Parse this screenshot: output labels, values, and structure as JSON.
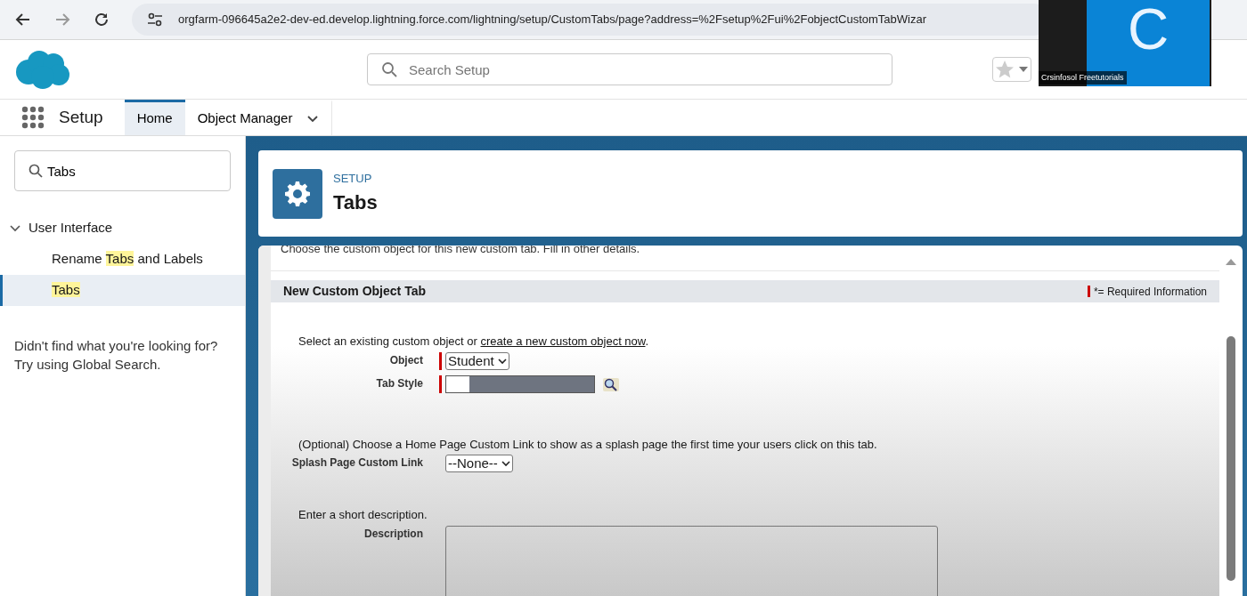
{
  "browser": {
    "url": "orgfarm-096645a2e2-dev-ed.develop.lightning.force.com/lightning/setup/CustomTabs/page?address=%2Fsetup%2Fui%2FobjectCustomTabWizar"
  },
  "header": {
    "search": {
      "placeholder": "Search Setup"
    }
  },
  "video_tile": {
    "initial": "C",
    "caption": "Crsinfosol Freetutorials"
  },
  "nav": {
    "app_name": "Setup",
    "tabs": [
      {
        "label": "Home",
        "selected": true,
        "has_menu": false
      },
      {
        "label": "Object Manager",
        "selected": false,
        "has_menu": true
      }
    ]
  },
  "sidebar": {
    "search": {
      "value": "Tabs"
    },
    "tree": [
      {
        "label": [
          {
            "text": "User Interface",
            "match": false
          }
        ],
        "expanded": true,
        "selected": false,
        "children": [
          {
            "label": [
              {
                "text": "Rename ",
                "match": false
              },
              {
                "text": "Tabs",
                "match": true
              },
              {
                "text": " and Labels",
                "match": false
              }
            ],
            "selected": false
          },
          {
            "label": [
              {
                "text": "Tabs",
                "match": true
              }
            ],
            "selected": true
          }
        ]
      }
    ],
    "help": [
      "Didn't find what you're looking for?",
      "Try using Global Search."
    ]
  },
  "page_header": {
    "eyebrow": "SETUP",
    "title": "Tabs"
  },
  "form": {
    "intro": "Choose the custom object for this new custom tab. Fill in other details.",
    "section_title": "New Custom Object Tab",
    "required_note": "*= Required Information",
    "groups": [
      {
        "prompt": [
          {
            "text": "Select an existing custom object or ",
            "link": false
          },
          {
            "text": "create a new custom object now",
            "link": true
          },
          {
            "text": ".",
            "link": false
          }
        ],
        "fields": [
          {
            "kind": "select",
            "label": "Object",
            "value": "Student",
            "required": true
          },
          {
            "kind": "style_picker",
            "label": "Tab Style",
            "required": true
          }
        ]
      },
      {
        "prompt": [
          {
            "text": "(Optional) Choose a Home Page Custom Link to show as a splash page the first time your users click on this tab.",
            "link": false
          }
        ],
        "fields": [
          {
            "kind": "select",
            "label": "Splash Page Custom Link",
            "value": "--None--",
            "required": false
          }
        ]
      },
      {
        "prompt": [
          {
            "text": "Enter a short description.",
            "link": false
          }
        ],
        "fields": [
          {
            "kind": "textarea",
            "label": "Description",
            "required": false
          }
        ]
      }
    ]
  }
}
